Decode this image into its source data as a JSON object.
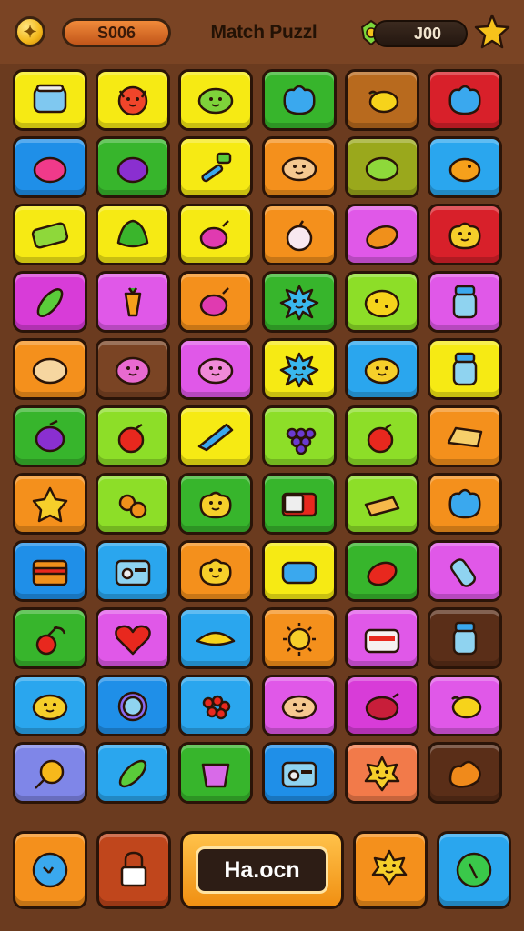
{
  "header": {
    "score": "S006",
    "title": "Match Puzzl",
    "gems": "J00"
  },
  "bottom_bar": {
    "match_label": "Ha.ocn"
  },
  "board": {
    "columns": 6,
    "rows": 11,
    "tiles": [
      {
        "color": "#f6ea14",
        "icon": "cushion-icon"
      },
      {
        "color": "#f6ea14",
        "icon": "devil-face-icon"
      },
      {
        "color": "#f6ea14",
        "icon": "green-blob-icon"
      },
      {
        "color": "#37b52c",
        "icon": "blue-creature-icon"
      },
      {
        "color": "#b86a1e",
        "icon": "lemon-icon"
      },
      {
        "color": "#d8202a",
        "icon": "blue-creature-icon"
      },
      {
        "color": "#1f8fe8",
        "icon": "berry-icon"
      },
      {
        "color": "#37b52c",
        "icon": "plum-icon"
      },
      {
        "color": "#f6ea14",
        "icon": "hammer-icon"
      },
      {
        "color": "#f4901c",
        "icon": "bun-face-icon"
      },
      {
        "color": "#9aa81c",
        "icon": "lime-icon"
      },
      {
        "color": "#2aa6ee",
        "icon": "orange-bird-icon"
      },
      {
        "color": "#f6ea14",
        "icon": "soap-icon"
      },
      {
        "color": "#f6ea14",
        "icon": "lettuce-icon"
      },
      {
        "color": "#f6ea14",
        "icon": "radish-icon"
      },
      {
        "color": "#f4901c",
        "icon": "onion-icon"
      },
      {
        "color": "#e058e8",
        "icon": "mango-icon"
      },
      {
        "color": "#d8202a",
        "icon": "yellow-blob-icon"
      },
      {
        "color": "#d83cd8",
        "icon": "pepper-icon"
      },
      {
        "color": "#e058e8",
        "icon": "carrot-icon"
      },
      {
        "color": "#f4901c",
        "icon": "radish-icon"
      },
      {
        "color": "#37b52c",
        "icon": "blue-splat-icon"
      },
      {
        "color": "#8dde28",
        "icon": "cheese-blob-icon"
      },
      {
        "color": "#e058e8",
        "icon": "jar-icon"
      },
      {
        "color": "#f4901c",
        "icon": "potato-icon"
      },
      {
        "color": "#7a4424",
        "icon": "pig-face-icon"
      },
      {
        "color": "#e058e8",
        "icon": "pink-blob-icon"
      },
      {
        "color": "#f6ea14",
        "icon": "blue-splat-icon"
      },
      {
        "color": "#2aa6ee",
        "icon": "chick-icon"
      },
      {
        "color": "#f6ea14",
        "icon": "jar-icon"
      },
      {
        "color": "#37b52c",
        "icon": "eggplant-icon"
      },
      {
        "color": "#8dde28",
        "icon": "tomato-icon"
      },
      {
        "color": "#f6ea14",
        "icon": "knife-icon"
      },
      {
        "color": "#8dde28",
        "icon": "grapes-icon"
      },
      {
        "color": "#8dde28",
        "icon": "tomato-icon"
      },
      {
        "color": "#f4901c",
        "icon": "bread-icon"
      },
      {
        "color": "#f4901c",
        "icon": "star-blob-icon"
      },
      {
        "color": "#8dde28",
        "icon": "pretzel-icon"
      },
      {
        "color": "#37b52c",
        "icon": "yellow-blob-icon"
      },
      {
        "color": "#37b52c",
        "icon": "book-icon"
      },
      {
        "color": "#8dde28",
        "icon": "cake-icon"
      },
      {
        "color": "#f4901c",
        "icon": "blue-creature-icon"
      },
      {
        "color": "#1f8fe8",
        "icon": "chest-icon"
      },
      {
        "color": "#2aa6ee",
        "icon": "radio-icon"
      },
      {
        "color": "#f4901c",
        "icon": "yellow-blob-icon"
      },
      {
        "color": "#f6ea14",
        "icon": "pill-box-icon"
      },
      {
        "color": "#37b52c",
        "icon": "chili-icon"
      },
      {
        "color": "#e058e8",
        "icon": "bottle-icon"
      },
      {
        "color": "#37b52c",
        "icon": "cherry-icon"
      },
      {
        "color": "#e058e8",
        "icon": "heart-icon"
      },
      {
        "color": "#2aa6ee",
        "icon": "taco-icon"
      },
      {
        "color": "#f4901c",
        "icon": "sun-icon"
      },
      {
        "color": "#e058e8",
        "icon": "toaster-icon"
      },
      {
        "color": "#5a2e18",
        "icon": "jar-icon"
      },
      {
        "color": "#2aa6ee",
        "icon": "chick-icon"
      },
      {
        "color": "#1f8fe8",
        "icon": "mirror-icon"
      },
      {
        "color": "#2aa6ee",
        "icon": "berries-icon"
      },
      {
        "color": "#e058e8",
        "icon": "bun-face-icon"
      },
      {
        "color": "#d83cd8",
        "icon": "red-onion-icon"
      },
      {
        "color": "#e058e8",
        "icon": "lemon-icon"
      },
      {
        "color": "#7f86e8",
        "icon": "lollipop-icon"
      },
      {
        "color": "#2aa6ee",
        "icon": "cucumber-icon"
      },
      {
        "color": "#37b52c",
        "icon": "bucket-icon"
      },
      {
        "color": "#1f8fe8",
        "icon": "radio-icon"
      },
      {
        "color": "#f27a4a",
        "icon": "sun-face-icon"
      },
      {
        "color": "#5a2e18",
        "icon": "splat-icon"
      }
    ]
  },
  "bottom_tiles": [
    {
      "color": "#f4901c",
      "icon": "blue-orb-icon"
    },
    {
      "color": "#c0461c",
      "icon": "lock-icon"
    },
    {
      "color": "#f4901c",
      "icon": "sun-face-icon"
    },
    {
      "color": "#2aa6ee",
      "icon": "green-orb-icon"
    }
  ]
}
